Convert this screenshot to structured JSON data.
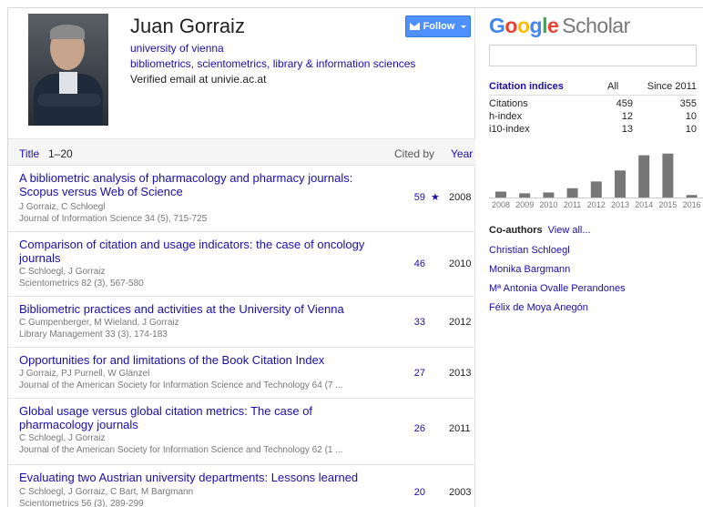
{
  "profile": {
    "name": "Juan Gorraiz",
    "affiliation": "university of vienna",
    "keywords": "bibliometrics, scientometrics, library & information sciences",
    "email": "Verified email at univie.ac.at",
    "follow_label": "Follow"
  },
  "table": {
    "title_label": "Title",
    "range": "1–20",
    "cited_label": "Cited by",
    "year_label": "Year",
    "rows": [
      {
        "title": "A bibliometric analysis of pharmacology and pharmacy journals: Scopus versus Web of Science",
        "authors": "J Gorraiz, C Schloegl",
        "venue": "Journal of Information Science 34 (5), 715-725",
        "cites": "59",
        "star": "★",
        "year": "2008"
      },
      {
        "title": "Comparison of citation and usage indicators: the case of oncology journals",
        "authors": "C Schloegl, J Gorraiz",
        "venue": "Scientometrics 82 (3), 567-580",
        "cites": "46",
        "star": "",
        "year": "2010"
      },
      {
        "title": "Bibliometric practices and activities at the University of Vienna",
        "authors": "C Gumpenberger, M Wieland, J Gorraiz",
        "venue": "Library Management 33 (3), 174-183",
        "cites": "33",
        "star": "",
        "year": "2012"
      },
      {
        "title": "Opportunities for and limitations of the Book Citation Index",
        "authors": "J Gorraiz, PJ Purnell, W Glänzel",
        "venue": "Journal of the American Society for Information Science and Technology 64 (7 ...",
        "cites": "27",
        "star": "",
        "year": "2013"
      },
      {
        "title": "Global usage versus global citation metrics: The case of pharmacology journals",
        "authors": "C Schloegl, J Gorraiz",
        "venue": "Journal of the American Society for Information Science and Technology 62 (1 ...",
        "cites": "26",
        "star": "",
        "year": "2011"
      },
      {
        "title": "Evaluating two Austrian university departments: Lessons learned",
        "authors": "C Schloegl, J Gorraiz, C Bart, M Bargmann",
        "venue": "Scientometrics 56 (3), 289-299",
        "cites": "20",
        "star": "",
        "year": "2003"
      }
    ]
  },
  "sidebar": {
    "logo_google": "Google",
    "logo_scholar": "Scholar",
    "search_value": "",
    "citation_indices": {
      "label": "Citation indices",
      "col_all": "All",
      "col_since": "Since 2011",
      "rows": [
        {
          "label": "Citations",
          "all": "459",
          "since": "355"
        },
        {
          "label": "h-index",
          "all": "12",
          "since": "10"
        },
        {
          "label": "i10-index",
          "all": "13",
          "since": "10"
        }
      ]
    },
    "coauthors_label": "Co-authors",
    "view_all": "View all...",
    "coauthors": [
      "Christian Schloegl",
      "Monika Bargmann",
      "Mª Antonia Ovalle Perandones",
      "Félix de Moya Anegón"
    ]
  },
  "colors": {
    "g_blue": "#4285f4",
    "g_red": "#ea4335",
    "g_yellow": "#fbbc05",
    "g_green": "#34a853",
    "link": "#1a0dab",
    "bar": "#777777"
  },
  "chart_data": {
    "type": "bar",
    "categories": [
      "2008",
      "2009",
      "2010",
      "2011",
      "2012",
      "2013",
      "2014",
      "2015",
      "2016"
    ],
    "values": [
      7,
      5,
      6,
      11,
      19,
      32,
      50,
      52,
      3
    ],
    "ylim": [
      0,
      56
    ],
    "grid": false
  }
}
